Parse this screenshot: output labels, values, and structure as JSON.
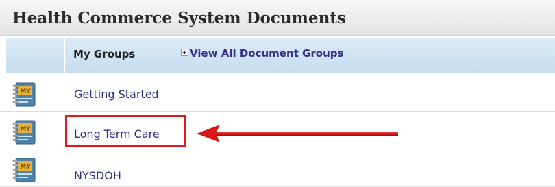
{
  "title": "Health Commerce System Documents",
  "header": {
    "my_groups_label": "My Groups",
    "view_all_label": "View All Document Groups"
  },
  "rows": [
    {
      "label": "Getting Started"
    },
    {
      "label": "Long Term Care"
    },
    {
      "label": "NYSDOH"
    }
  ],
  "icons": {
    "group_icon": "notebook-my-icon",
    "expand_icon": "plus-box-icon"
  },
  "annotation": {
    "highlighted_item": "Long Term Care",
    "color": "#e01b1b"
  }
}
